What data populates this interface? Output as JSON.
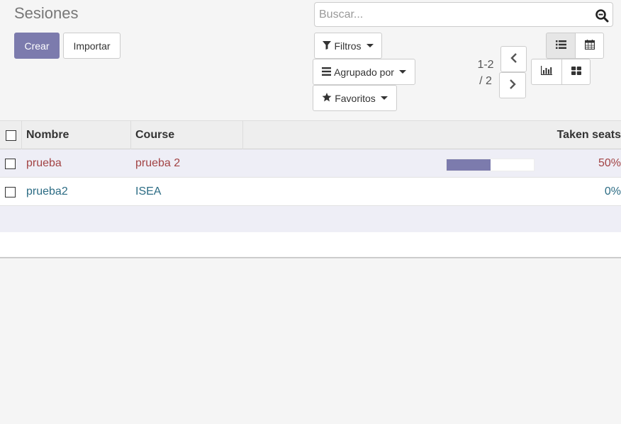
{
  "page": {
    "title": "Sesiones"
  },
  "buttons": {
    "create": "Crear",
    "import": "Importar"
  },
  "search": {
    "placeholder": "Buscar..."
  },
  "filters": {
    "filters": "Filtros",
    "group_by": "Agrupado por",
    "favorites": "Favoritos"
  },
  "pager": {
    "range": "1-2",
    "total": "/ 2"
  },
  "views": [
    "list",
    "calendar",
    "graph",
    "kanban"
  ],
  "table": {
    "columns": [
      "Nombre",
      "Course",
      "Taken seats"
    ],
    "rows": [
      {
        "name": "prueba",
        "course": "prueba 2",
        "taken_seats_percent": 50,
        "taken_seats_label": "50%",
        "show_bar": true
      },
      {
        "name": "prueba2",
        "course": "ISEA",
        "taken_seats_percent": 0,
        "taken_seats_label": "0%",
        "show_bar": false
      }
    ]
  },
  "colors": {
    "primary": "#7c7bad",
    "link_red": "#a24344",
    "link_teal": "#2c6c84"
  }
}
